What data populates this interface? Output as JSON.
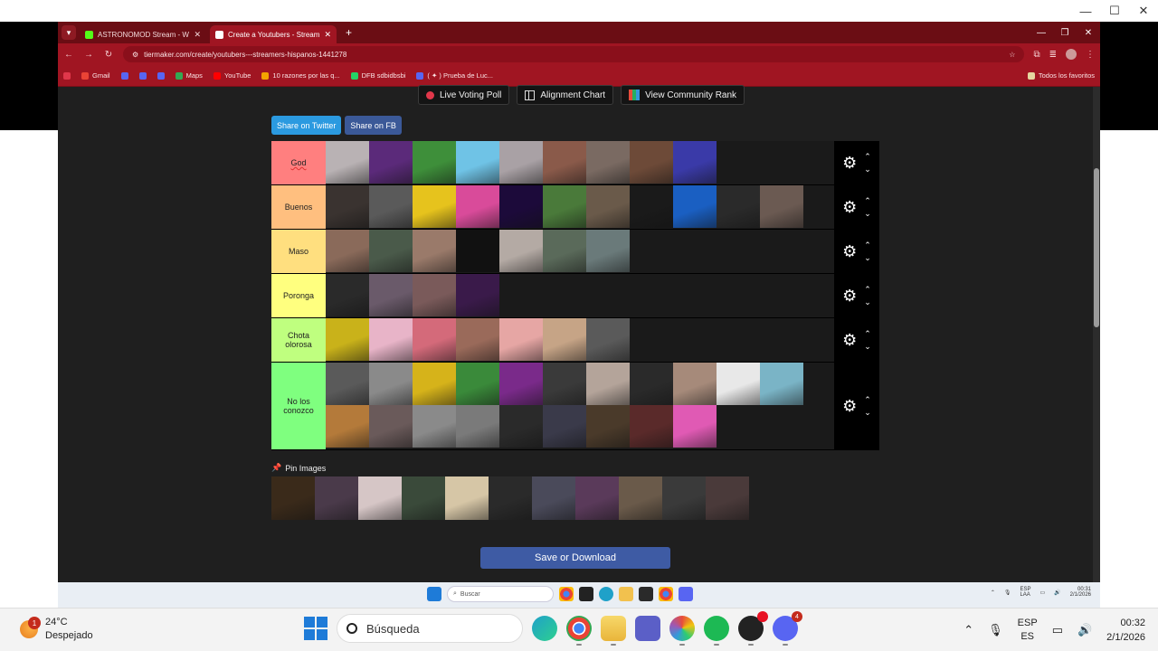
{
  "tabs": [
    {
      "title": "ASTRONOMOD Stream - Watch",
      "color": "#53fc18"
    },
    {
      "title": "Create a Youtubers - Streamers",
      "color": "#ffffff"
    }
  ],
  "address": {
    "url": "tiermaker.com/create/youtubers---streamers-hispanos-1441278"
  },
  "bookmarks": [
    {
      "label": "Gmail",
      "color": "#ea4335"
    },
    {
      "label": "",
      "color": "#5865f2"
    },
    {
      "label": "",
      "color": "#5865f2"
    },
    {
      "label": "",
      "color": "#5865f2"
    },
    {
      "label": "Maps",
      "color": "#34a853"
    },
    {
      "label": "YouTube",
      "color": "#ff0000"
    },
    {
      "label": "10 razones por las q...",
      "color": "#f4a300"
    },
    {
      "label": "DFB sdbidbsbi",
      "color": "#25d366"
    },
    {
      "label": "( ✦ ) Prueba de Luc...",
      "color": "#5865f2"
    }
  ],
  "bookmarks_all": "Todos los favoritos",
  "top_buttons": {
    "live_poll": "Live Voting Poll",
    "alignment": "Alignment Chart",
    "community": "View Community Rank"
  },
  "share": {
    "twitter": "Share on Twitter",
    "fb": "Share on FB"
  },
  "tiers": [
    {
      "label": "God",
      "color": "#ff7f7f",
      "count": 9,
      "colors": [
        "#b9b2b4",
        "#5b2a7a",
        "#3e8f3a",
        "#6fc3e6",
        "#a9a1a5",
        "#8a5a4a",
        "#7a6a62",
        "#6d4a38",
        "#3a3aa8"
      ]
    },
    {
      "label": "Buenos",
      "color": "#ffbf7f",
      "count": 11,
      "colors": [
        "#3a3330",
        "#5a5a5a",
        "#e6c31d",
        "#d94b9a",
        "#1c0a3a",
        "#4a7a3a",
        "#6a5a4a",
        "#1a1a1a",
        "#1a5fc2",
        "#2a2a2a",
        "#6b5a52"
      ]
    },
    {
      "label": "Maso",
      "color": "#ffdf7f",
      "count": 7,
      "colors": [
        "#8a6a5a",
        "#4a5a4a",
        "#9a7a6a",
        "#111111",
        "#b4aaa4",
        "#5a6a5a",
        "#6a7a7a"
      ]
    },
    {
      "label": "Poronga",
      "color": "#ffff7f",
      "count": 4,
      "colors": [
        "#2a2a2a",
        "#6a5a6a",
        "#7a5a5a",
        "#3a1a4a"
      ]
    },
    {
      "label": "Chota olorosa",
      "color": "#bfff7f",
      "count": 7,
      "colors": [
        "#c9b21a",
        "#e8b4c8",
        "#d46a7a",
        "#9a6a5a",
        "#e6a6a4",
        "#c6a486",
        "#5a5a5a"
      ]
    },
    {
      "label": "No los conozco",
      "color": "#7fff7f",
      "count": 20,
      "colors": [
        "#5a5a5a",
        "#8a8a8a",
        "#d6b31a",
        "#3a8a3a",
        "#7a2a8a",
        "#3a3a3a",
        "#b4a49a",
        "#2a2a2a",
        "#a68a7a",
        "#e8e8e8",
        "#7ab4c6",
        "#b47a3a",
        "#6a5a5a",
        "#8a8a8a",
        "#7a7a7a",
        "#2a2a2a",
        "#3a3a4a",
        "#4a3a2a",
        "#5a2a2a",
        "#e05ab4"
      ]
    }
  ],
  "pin_label": "Pin Images",
  "pool_colors": [
    "#3a2a1a",
    "#4a3a4a",
    "#d6c6c6",
    "#3a4a3a",
    "#d6c6a6",
    "#2a2a2a",
    "#4a4a5a",
    "#5a3a5a",
    "#6a5a4a",
    "#3a3a3a",
    "#4a3a3a"
  ],
  "save_label": "Save or Download",
  "inner_taskbar": {
    "search": "Buscar",
    "lang1": "ESP",
    "lang2": "LAA",
    "time": "00:31",
    "date": "2/1/2026"
  },
  "taskbar": {
    "temp": "24°C",
    "weather": "Despejado",
    "weather_badge": "1",
    "search": "Búsqueda",
    "lang1": "ESP",
    "lang2": "ES",
    "time": "00:32",
    "date": "2/1/2026",
    "discord_badge": "4"
  }
}
